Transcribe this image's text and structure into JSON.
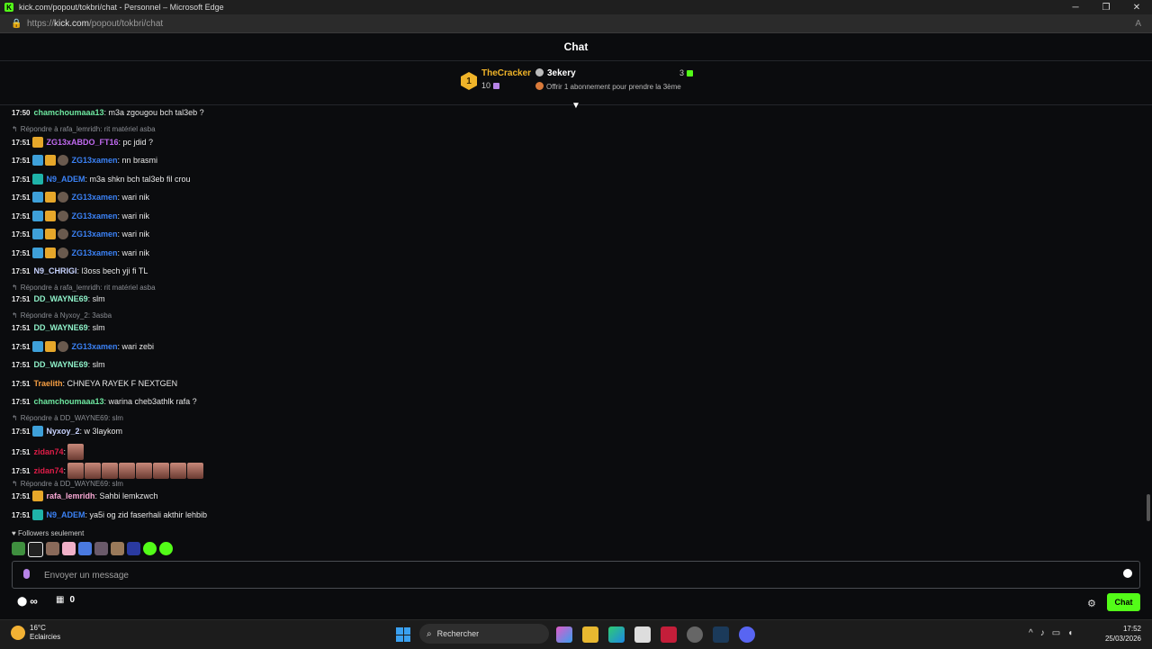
{
  "window": {
    "title": "kick.com/popout/tokbri/chat - Personnel – Microsoft Edge",
    "url_prefix": "https://",
    "url_host": "kick.com",
    "url_path": "/popout/tokbri/chat"
  },
  "chat": {
    "header": "Chat",
    "leaderboard": {
      "rank": "1",
      "first_name": "TheCracker",
      "first_count": "10",
      "second_name": "3ekery",
      "second_count": "3",
      "offer": "Offrir 1 abonnement pour prendre la 3ème"
    },
    "messages": [
      {
        "time": "17:50",
        "user": "chamchoumaaa13",
        "color": "#6ee7a0",
        "text": ": m3a zgougou bch tal3eb ?",
        "badges": []
      },
      {
        "reply": "Répondre à rafa_lemridh: rit matériel asba"
      },
      {
        "time": "17:51",
        "user": "ZG13xABDO_FT16",
        "color": "#c06af0",
        "text": ": pc jdid ?",
        "badges": [
          "crown"
        ]
      },
      {
        "time": "17:51",
        "user": "ZG13xamen",
        "color": "#3b82f6",
        "text": ": nn brasmi",
        "badges": [
          "vip",
          "crown",
          "sub"
        ]
      },
      {
        "time": "17:51",
        "user": "N9_ADEM",
        "color": "#3b82f6",
        "text": ": m3a shkn bch tal3eb fil crou",
        "badges": [
          "mod"
        ]
      },
      {
        "time": "17:51",
        "user": "ZG13xamen",
        "color": "#3b82f6",
        "text": ": wari nik",
        "badges": [
          "vip",
          "crown",
          "sub"
        ]
      },
      {
        "time": "17:51",
        "user": "ZG13xamen",
        "color": "#3b82f6",
        "text": ": wari nik",
        "badges": [
          "vip",
          "crown",
          "sub"
        ]
      },
      {
        "time": "17:51",
        "user": "ZG13xamen",
        "color": "#3b82f6",
        "text": ": wari nik",
        "badges": [
          "vip",
          "crown",
          "sub"
        ]
      },
      {
        "time": "17:51",
        "user": "ZG13xamen",
        "color": "#3b82f6",
        "text": ": wari nik",
        "badges": [
          "vip",
          "crown",
          "sub"
        ]
      },
      {
        "time": "17:51",
        "user": "N9_CHRIGI",
        "color": "#c7d2fe",
        "text": ": l3oss bech yji fi TL",
        "badges": []
      },
      {
        "reply": "Répondre à rafa_lemridh: rit matériel asba"
      },
      {
        "time": "17:51",
        "user": "DD_WAYNE69",
        "color": "#8ef0c8",
        "text": ": slm",
        "badges": []
      },
      {
        "reply": "Répondre à Nyxoy_2: 3asba"
      },
      {
        "time": "17:51",
        "user": "DD_WAYNE69",
        "color": "#8ef0c8",
        "text": ": slm",
        "badges": []
      },
      {
        "time": "17:51",
        "user": "ZG13xamen",
        "color": "#3b82f6",
        "text": ": wari zebi",
        "badges": [
          "vip",
          "crown",
          "sub"
        ]
      },
      {
        "time": "17:51",
        "user": "DD_WAYNE69",
        "color": "#8ef0c8",
        "text": ": slm",
        "badges": []
      },
      {
        "time": "17:51",
        "user": "Traelith",
        "color": "#f59e42",
        "text": ": CHNEYA RAYEK F NEXTGEN",
        "badges": []
      },
      {
        "time": "17:51",
        "user": "chamchoumaaa13",
        "color": "#6ee7a0",
        "text": ": warina cheb3athlk rafa ?",
        "badges": []
      },
      {
        "reply": "Répondre à DD_WAYNE69: slm"
      },
      {
        "time": "17:51",
        "user": "Nyxoy_2",
        "color": "#c7d2fe",
        "text": ": w 3laykom",
        "badges": [
          "vip"
        ]
      },
      {
        "time": "17:51",
        "user": "zidan74",
        "color": "#e11d48",
        "text": ":",
        "badges": [],
        "emotes": 1
      },
      {
        "time": "17:51",
        "user": "zidan74",
        "color": "#e11d48",
        "text": ":",
        "badges": [],
        "emotes": 8
      },
      {
        "reply": "Répondre à DD_WAYNE69: slm"
      },
      {
        "time": "17:51",
        "user": "rafa_lemridh",
        "color": "#f9a8d4",
        "text": ": Sahbi lemkzwch",
        "badges": [
          "crown"
        ]
      },
      {
        "time": "17:51",
        "user": "N9_ADEM",
        "color": "#3b82f6",
        "text": ": ya5i og zid faserhali akthir lehbib",
        "badges": [
          "mod"
        ]
      }
    ],
    "followers_label": "Followers seulement",
    "input_placeholder": "Envoyer un message",
    "points": "0",
    "chat_button": "Chat"
  },
  "taskbar": {
    "temp": "16°C",
    "weather": "Eclaircies",
    "search": "Rechercher",
    "time": "17:52",
    "date": "25/03/2026"
  }
}
